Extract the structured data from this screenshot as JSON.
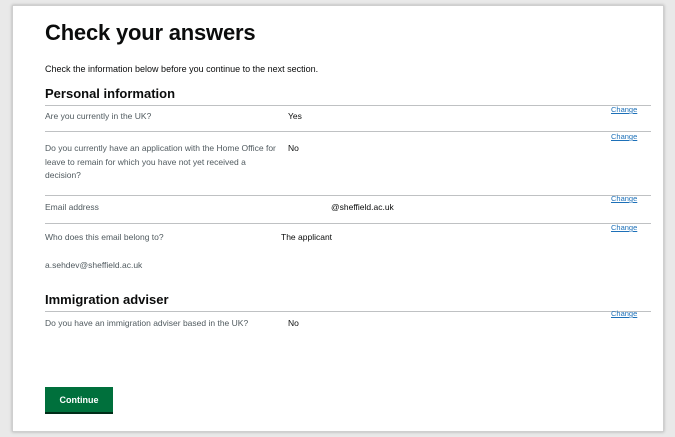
{
  "page": {
    "title": "Check your answers",
    "intro": "Check the information below before you continue to the next section."
  },
  "sections": [
    {
      "heading": "Personal information",
      "rows": [
        {
          "key": "Are you currently in the UK?",
          "value": "Yes",
          "action": "Change"
        },
        {
          "key": "Do you currently have an application with the Home Office for leave to remain for which you have not yet received a decision?",
          "value": "No",
          "action": "Change"
        },
        {
          "key": "Email address",
          "value": "@sheffield.ac.uk",
          "action": "Change"
        },
        {
          "key": "Who does this email belong to?",
          "value": "The applicant",
          "action": "Change",
          "extra": "a.sehdev@sheffield.ac.uk"
        }
      ]
    },
    {
      "heading": "Immigration adviser",
      "rows": [
        {
          "key": "Do you have an immigration adviser based in the UK?",
          "value": "No",
          "action": "Change"
        }
      ]
    }
  ],
  "continue_label": "Continue"
}
